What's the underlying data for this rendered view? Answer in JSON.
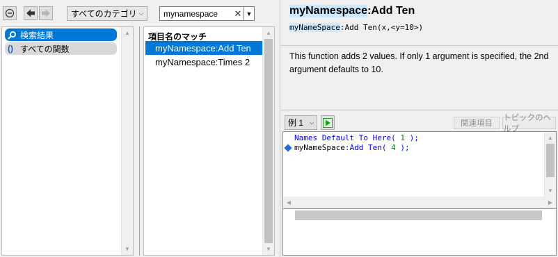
{
  "toolbar": {
    "category_value": "すべてのカテゴリ",
    "search_value": "mynamespace",
    "search_placeholder": ""
  },
  "categories": [
    {
      "label": "検索結果",
      "selected": true
    },
    {
      "label": "すべての関数",
      "selected": false
    }
  ],
  "matches": {
    "header": "項目名のマッチ",
    "items": [
      {
        "label": "myNamespace:Add Ten",
        "selected": true
      },
      {
        "label": "myNamespace:Times 2",
        "selected": false
      }
    ]
  },
  "function": {
    "title_highlight": "myNamespace",
    "title_rest": ":Add Ten",
    "sig_highlight": "myNameSpace",
    "sig_rest": ":Add Ten(x,<y=10>)",
    "description": "This function adds 2 values. If only 1 argument is specified, the 2nd argument defaults to 10."
  },
  "example": {
    "selector": "例 1",
    "related_button": "関連項目",
    "topic_help_button": "トピックのヘルプ",
    "code": {
      "line1_kw": "Names Default To Here(",
      "line1_num": " 1 ",
      "line1_end": ");",
      "line2_prefix": "myNameSpace",
      "line2_mid": ":Add Ten(",
      "line2_num": " 4 ",
      "line2_end": ");"
    }
  },
  "colors": {
    "selection": "#0078d7",
    "highlight": "#cce8ff",
    "keyword": "#0000ff",
    "number": "#008000"
  }
}
